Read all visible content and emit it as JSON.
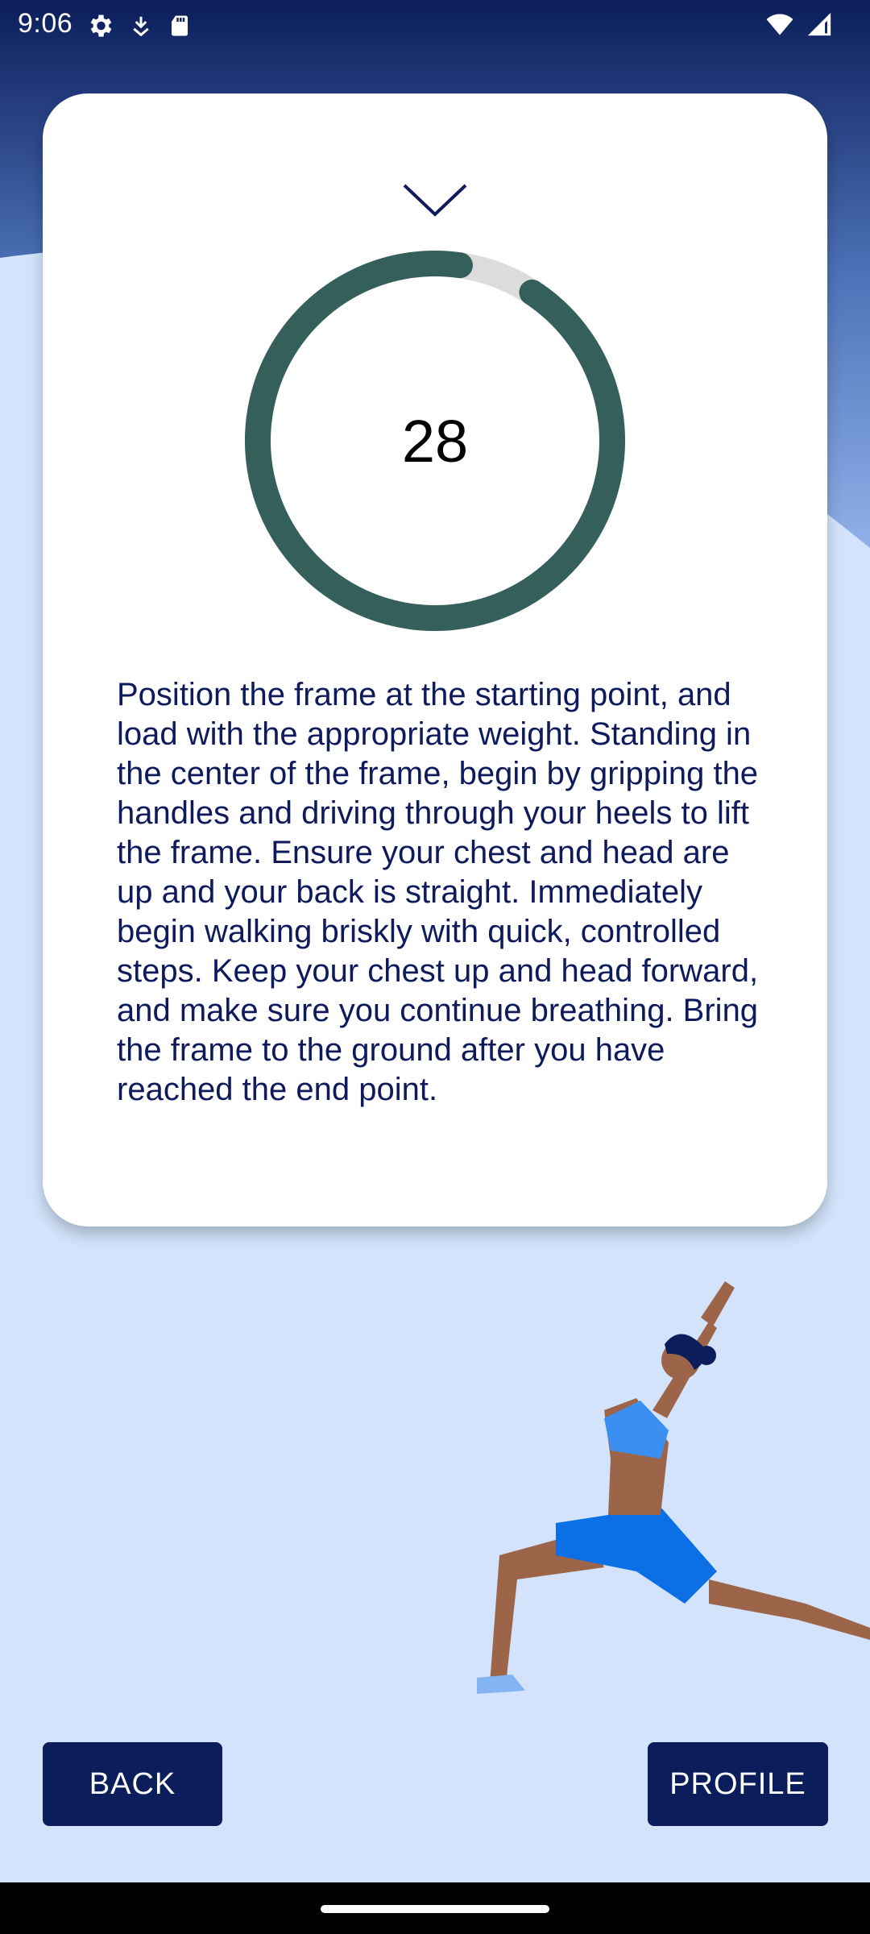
{
  "status_bar": {
    "time": "9:06",
    "left_icons": [
      "settings-icon",
      "download-icon",
      "sd-card-icon"
    ],
    "right_icons": [
      "wifi-icon",
      "signal-icon"
    ]
  },
  "card": {
    "collapse_icon": "chevron-down-icon",
    "timer": {
      "value": "28",
      "progress_fraction": 0.93
    },
    "instructions": "Position the frame at the starting point, and load with the appropriate weight. Standing in the center of the frame, begin by gripping the handles and driving through your heels to lift the frame. Ensure your chest and head are up and your back is straight. Immediately begin walking briskly with quick, controlled steps. Keep your chest up and head forward, and make sure you continue breathing. Bring the frame to the ground after you have reached the end point."
  },
  "buttons": {
    "back_label": "BACK",
    "profile_label": "PROFILE"
  },
  "colors": {
    "background_light": "#d2e3fb",
    "background_dark": "#0b1d5a",
    "ring_progress": "#355f5a",
    "ring_track": "#dcdcdc",
    "text": "#0e1a5c",
    "button": "#0b1d5a"
  }
}
